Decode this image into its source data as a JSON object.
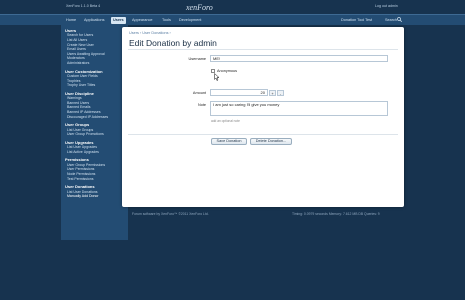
{
  "header": {
    "logo": "xenForo",
    "version": "XenForo 1.1.0 Beta 4",
    "logout": "Log out admin",
    "tabs": [
      "Home",
      "Applications",
      "Users",
      "Appearance",
      "Tools",
      "Development"
    ],
    "active_tab": "Users",
    "quick_search": "Donation Tool Test",
    "search": "Search"
  },
  "sidebar": {
    "groups": [
      {
        "title": "Users",
        "items": [
          "Search for Users",
          "List All Users",
          "Create New User",
          "Email Users",
          "Users Awaiting Approval",
          "Moderators",
          "Administrators"
        ]
      },
      {
        "title": "User Customization",
        "items": [
          "Custom User Fields",
          "Trophies",
          "Trophy User Titles"
        ]
      },
      {
        "title": "User Discipline",
        "items": [
          "Warnings",
          "Banned Users",
          "Banned Emails",
          "Banned IP Addresses",
          "Discouraged IP Addresses"
        ]
      },
      {
        "title": "User Groups",
        "items": [
          "List User Groups",
          "User Group Promotions"
        ]
      },
      {
        "title": "User Upgrades",
        "items": [
          "List User Upgrades",
          "List Active Upgrades"
        ]
      },
      {
        "title": "Permissions",
        "items": [
          "User Group Permissions",
          "User Permissions",
          "Node Permissions",
          "Test Permissions"
        ]
      },
      {
        "title": "User Donations",
        "items": [
          "List User Donations",
          "Manually Add Donor"
        ]
      }
    ],
    "current_item": "Manually Add Donor"
  },
  "page": {
    "breadcrumb": [
      "Users",
      "User Donations"
    ],
    "title": "Edit Donation by admin",
    "username_label": "Username",
    "username_value": "ME!",
    "anonymous_label": "Anonymous",
    "amount_label": "Amount",
    "amount_value": "20",
    "note_label": "Note",
    "note_value": "I am just so caring I'll give you money",
    "note_hint": "add an optional note",
    "save_button": "Save Donation",
    "delete_button": "Delete Donation..."
  },
  "footer": {
    "copyright": "Forum software by XenForo™ ©2011 XenForo Ltd.",
    "timing": "Timing: 0.0979 seconds Memory: 7.612 MB DB Queries: 9"
  }
}
